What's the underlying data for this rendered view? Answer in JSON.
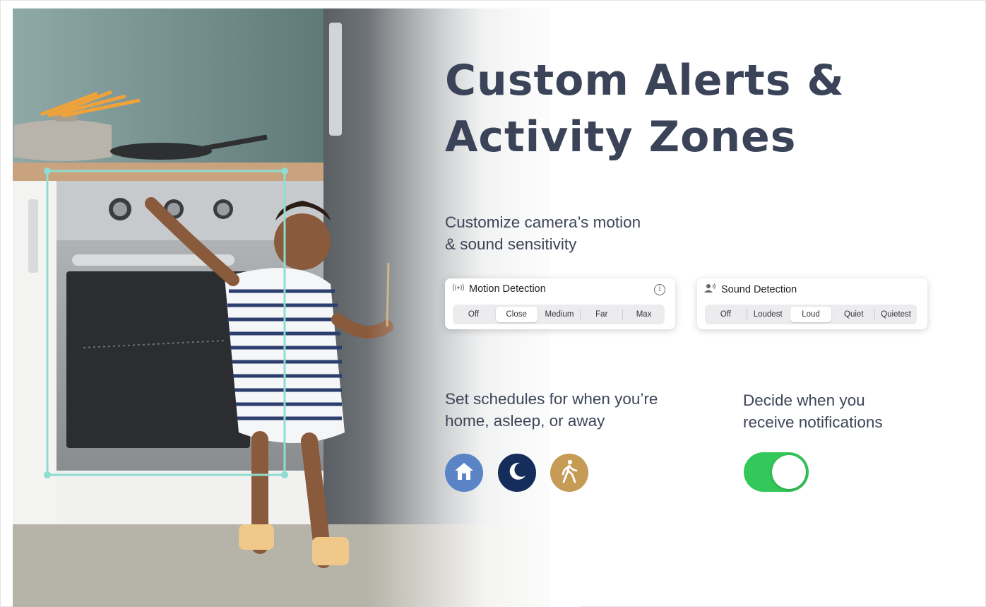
{
  "headline": {
    "line1": "Custom Alerts &",
    "line2": "Activity Zones"
  },
  "sensitivity_text": {
    "line1": "Customize camera’s motion",
    "line2": "& sound sensitivity"
  },
  "motion_card": {
    "title": "Motion Detection",
    "options": [
      "Off",
      "Close",
      "Medium",
      "Far",
      "Max"
    ],
    "selected": "Close",
    "icon": "motion-waves-icon"
  },
  "sound_card": {
    "title": "Sound Detection",
    "options": [
      "Off",
      "Loudest",
      "Loud",
      "Quiet",
      "Quietest"
    ],
    "selected": "Loud",
    "icon": "person-sound-icon"
  },
  "schedule_text": {
    "line1": "Set schedules for when you’re",
    "line2": "home, asleep, or away"
  },
  "schedule_modes": [
    {
      "mode": "home",
      "icon": "house-icon",
      "color": "#5b84c6"
    },
    {
      "mode": "asleep",
      "icon": "moon-icon",
      "color": "#142d5a"
    },
    {
      "mode": "away",
      "icon": "walking-person-icon",
      "color": "#c59b55"
    }
  ],
  "notifications_text": {
    "line1": "Decide when you",
    "line2": "receive notifications"
  },
  "notifications_toggle": {
    "state": "on",
    "color": "#34c759"
  },
  "colors": {
    "headline": "#3a4358",
    "activity_zone_outline": "#8fdcd0"
  }
}
